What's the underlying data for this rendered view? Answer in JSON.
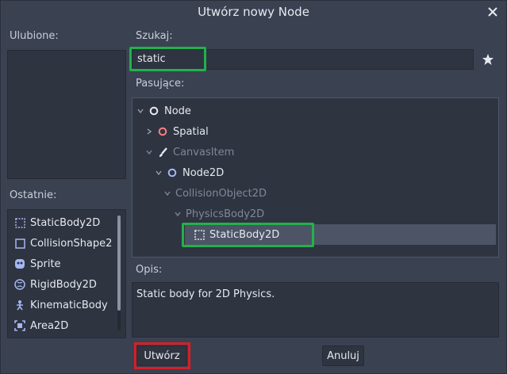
{
  "dialog": {
    "title": "Utwórz nowy Node",
    "favorites_label": "Ulubione:",
    "recent_label": "Ostatnie:",
    "search_label": "Szukaj:",
    "search_value": "static",
    "matches_label": "Pasujące:",
    "description_label": "Opis:",
    "description_text": "Static body for 2D Physics.",
    "create_button": "Utwórz",
    "cancel_button": "Anuluj"
  },
  "recent": [
    {
      "label": "StaticBody2D",
      "icon": "staticbody2d-icon"
    },
    {
      "label": "CollisionShape2",
      "icon": "collisionshape2d-icon"
    },
    {
      "label": "Sprite",
      "icon": "sprite-icon"
    },
    {
      "label": "RigidBody2D",
      "icon": "rigidbody2d-icon"
    },
    {
      "label": "KinematicBody",
      "icon": "kinematicbody-icon"
    },
    {
      "label": "Area2D",
      "icon": "area2d-icon"
    }
  ],
  "tree": [
    {
      "label": "Node",
      "icon": "node-circle-icon",
      "state": "expanded",
      "enabled": true
    },
    {
      "label": "Spatial",
      "icon": "spatial-circle-icon",
      "state": "collapsed",
      "enabled": true
    },
    {
      "label": "CanvasItem",
      "icon": "brush-icon",
      "state": "expanded",
      "enabled": false
    },
    {
      "label": "Node2D",
      "icon": "node2d-circle-icon",
      "state": "expanded",
      "enabled": true
    },
    {
      "label": "CollisionObject2D",
      "icon": "",
      "state": "expanded",
      "enabled": false
    },
    {
      "label": "PhysicsBody2D",
      "icon": "",
      "state": "expanded",
      "enabled": false
    },
    {
      "label": "StaticBody2D",
      "icon": "staticbody2d-icon",
      "state": "leaf",
      "enabled": true,
      "selected": true
    }
  ],
  "colors": {
    "highlight_green": "#22b14c",
    "highlight_red": "#d61f26",
    "node_icon": "#e6e9ef",
    "spatial_icon": "#fc7f7f",
    "node2d_icon": "#a5b7f3"
  }
}
